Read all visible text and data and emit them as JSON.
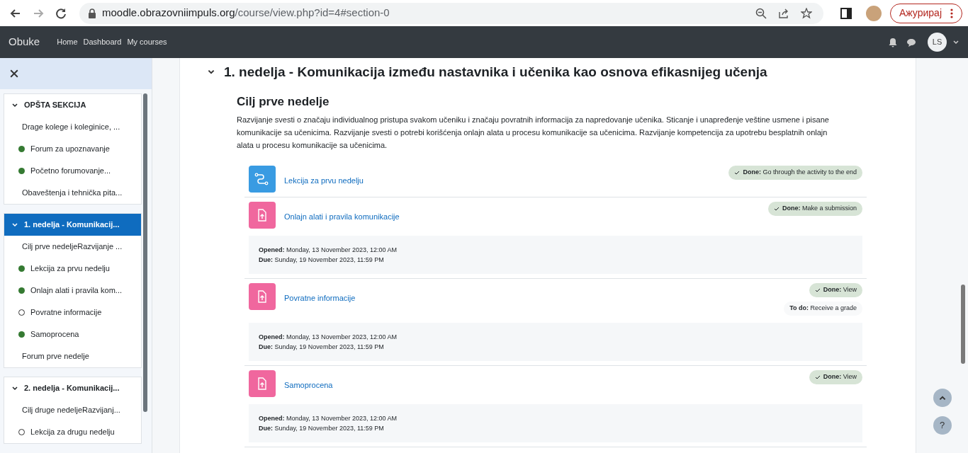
{
  "browser": {
    "url_host": "moodle.obrazovniimpuls.org",
    "url_path": "/course/view.php?id=4#section-0",
    "update_button": "Ажурирај"
  },
  "navbar": {
    "brand": "Obuke",
    "links": [
      "Home",
      "Dashboard",
      "My courses"
    ],
    "avatar_initials": "LS"
  },
  "course_index": {
    "sections": [
      {
        "title": "OPŠTA SEKCIJA",
        "selected": false,
        "expanded": true,
        "items": [
          {
            "kind": "label",
            "text": "Drage kolege i koleginice, ..."
          },
          {
            "kind": "activity",
            "text": "Forum za upoznavanje",
            "completed": true
          },
          {
            "kind": "activity",
            "text": "Početno forumovanje...",
            "completed": true
          },
          {
            "kind": "label",
            "text": "Obaveštenja i tehnička pita..."
          }
        ]
      },
      {
        "title": "1. nedelja - Komunikacij...",
        "selected": true,
        "expanded": true,
        "items": [
          {
            "kind": "label",
            "text": "Cilj prve nedeljeRazvijanje ..."
          },
          {
            "kind": "activity",
            "text": "Lekcija za prvu nedelju",
            "completed": true
          },
          {
            "kind": "activity",
            "text": "Onlajn alati i pravila kom...",
            "completed": true
          },
          {
            "kind": "activity",
            "text": "Povratne informacije",
            "completed": false
          },
          {
            "kind": "activity",
            "text": "Samoprocena",
            "completed": true
          },
          {
            "kind": "label",
            "text": "Forum prve nedelje"
          }
        ]
      },
      {
        "title": "2. nedelja - Komunikacij...",
        "selected": false,
        "expanded": true,
        "items": [
          {
            "kind": "label",
            "text": "Cilj druge nedeljeRazvijanj..."
          },
          {
            "kind": "activity",
            "text": "Lekcija za drugu nedelju",
            "completed": false
          }
        ]
      }
    ]
  },
  "section": {
    "title": "1. nedelja - Komunikacija između nastavnika i učenika kao osnova efikasnijeg učenja",
    "expanded": true,
    "summary_title": "Cilj prve nedelje",
    "summary": "Razvijanje svesti o značaju individualnog pristupa svakom učeniku i značaju povratnih informacija za napredovanje učenika. Sticanje i unapređenje veštine usmene i pisane komunikacije sa učenicima. Razvijanje svesti o potrebi korišćenja onlajn alata u procesu komunikacije sa učenicima. Razvijanje kompetencija za upotrebu besplatnih onlajn alata u procesu komunikacije sa učenicima.",
    "activities": [
      {
        "kind": "lesson",
        "name": "Lekcija za prvu nedelju",
        "completion": [
          {
            "done": true,
            "label": "Done:",
            "text": "Go through the activity to the end"
          }
        ]
      },
      {
        "kind": "assignment",
        "name": "Onlajn alati i pravila komunikacije",
        "completion": [
          {
            "done": true,
            "label": "Done:",
            "text": "Make a submission"
          }
        ],
        "dates": [
          {
            "label": "Opened:",
            "value": "Monday, 13 November 2023, 12:00 AM"
          },
          {
            "label": "Due:",
            "value": "Sunday, 19 November 2023, 11:59 PM"
          }
        ]
      },
      {
        "kind": "assignment",
        "name": "Povratne informacije",
        "completion": [
          {
            "done": true,
            "label": "Done:",
            "text": "View"
          },
          {
            "done": false,
            "label": "To do:",
            "text": "Receive a grade"
          }
        ],
        "dates": [
          {
            "label": "Opened:",
            "value": "Monday, 13 November 2023, 12:00 AM"
          },
          {
            "label": "Due:",
            "value": "Sunday, 19 November 2023, 11:59 PM"
          }
        ]
      },
      {
        "kind": "assignment",
        "name": "Samoprocena",
        "completion": [
          {
            "done": true,
            "label": "Done:",
            "text": "View"
          }
        ],
        "dates": [
          {
            "label": "Opened:",
            "value": "Monday, 13 November 2023, 12:00 AM"
          },
          {
            "label": "Due:",
            "value": "Sunday, 19 November 2023, 11:59 PM"
          }
        ]
      }
    ]
  },
  "help_button": "?"
}
